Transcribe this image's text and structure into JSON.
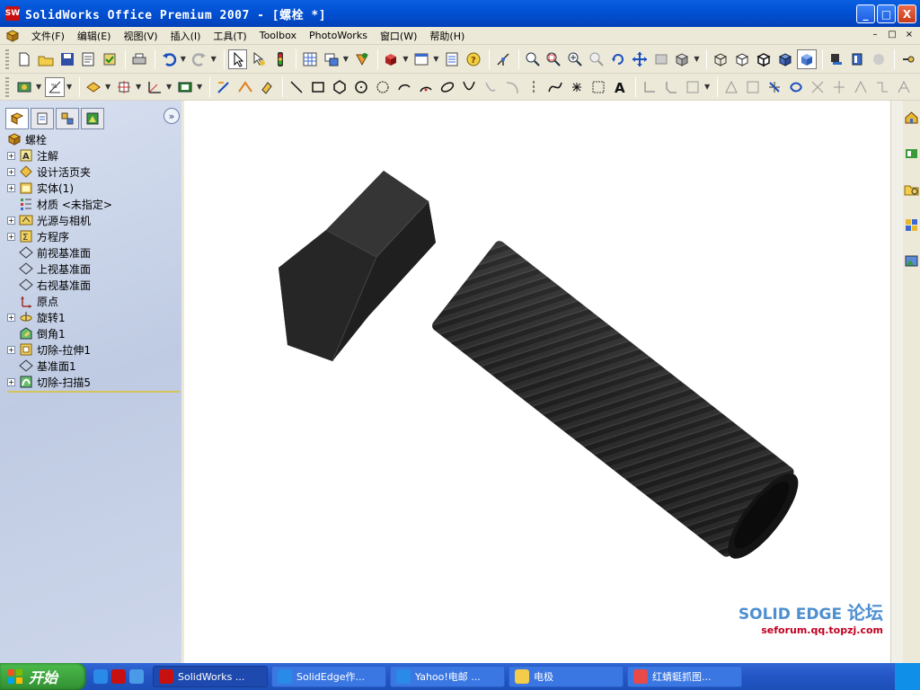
{
  "window": {
    "title": "SolidWorks Office Premium 2007 - [螺栓 *]",
    "app_icon_text": "SW",
    "controls": {
      "minimize": "_",
      "maximize": "□",
      "close": "X"
    }
  },
  "menubar": {
    "items": [
      "文件(F)",
      "编辑(E)",
      "视图(V)",
      "插入(I)",
      "工具(T)",
      "Toolbox",
      "PhotoWorks",
      "窗口(W)",
      "帮助(H)"
    ],
    "mdi_controls": [
      "–",
      "□",
      "×"
    ]
  },
  "toolbar_standard": {
    "icons": [
      "new-icon",
      "open-icon",
      "save-icon",
      "print-preview-icon",
      "rebuild-icon",
      "print-icon",
      "undo-icon",
      "redo-icon",
      "select-icon",
      "sketch-select-icon",
      "traffic-light-icon",
      "grid-icon",
      "options-icon",
      "render-icon",
      "appearance-icon",
      "view-orientation-icon",
      "list-icon",
      "help-icon",
      "zoom-fit-icon",
      "zoom-area-icon",
      "zoom-in-out-icon",
      "zoom-selection-icon",
      "rotate-icon",
      "pan-icon",
      "3d-view-icon",
      "display-style-icon",
      "wireframe-icon",
      "hidden-lines-icon",
      "hidden-removed-icon",
      "shaded-edges-icon",
      "shaded-icon",
      "shadow-icon",
      "perspective-icon",
      "section-icon"
    ]
  },
  "toolbar_sketch": {
    "icons": [
      "sketch-icon",
      "smart-dimension-icon",
      "line-icon",
      "rectangle-icon",
      "polygon-icon",
      "circle-icon",
      "arc-icon",
      "centerpoint-arc-icon",
      "ellipse-icon",
      "parabola-icon",
      "spline-icon",
      "point-icon",
      "centerline-icon",
      "text-icon",
      "mirror-icon",
      "offset-icon",
      "trim-icon",
      "extend-icon",
      "relation-icon",
      "pattern-icon"
    ]
  },
  "feature_manager": {
    "tabs": [
      "feature-tree-tab",
      "property-manager-tab",
      "configuration-tab",
      "dimxpert-tab"
    ],
    "expand_label": "»",
    "root": "螺栓",
    "nodes": [
      {
        "label": "注解",
        "expandable": true,
        "icon": "annotations-icon"
      },
      {
        "label": "设计活页夹",
        "expandable": true,
        "icon": "design-binder-icon"
      },
      {
        "label": "实体(1)",
        "expandable": true,
        "icon": "solid-bodies-icon"
      },
      {
        "label": "材质 <未指定>",
        "expandable": false,
        "icon": "material-icon"
      },
      {
        "label": "光源与相机",
        "expandable": true,
        "icon": "lights-cameras-icon"
      },
      {
        "label": "方程序",
        "expandable": true,
        "icon": "equations-icon"
      },
      {
        "label": "前视基准面",
        "expandable": false,
        "icon": "plane-icon"
      },
      {
        "label": "上视基准面",
        "expandable": false,
        "icon": "plane-icon"
      },
      {
        "label": "右视基准面",
        "expandable": false,
        "icon": "plane-icon"
      },
      {
        "label": "原点",
        "expandable": false,
        "icon": "origin-icon"
      },
      {
        "label": "旋转1",
        "expandable": true,
        "icon": "revolve-icon"
      },
      {
        "label": "倒角1",
        "expandable": false,
        "icon": "chamfer-icon"
      },
      {
        "label": "切除-拉伸1",
        "expandable": true,
        "icon": "cut-extrude-icon"
      },
      {
        "label": "基准面1",
        "expandable": false,
        "icon": "plane-icon"
      },
      {
        "label": "切除-扫描5",
        "expandable": true,
        "icon": "cut-sweep-icon"
      }
    ]
  },
  "viewport": {
    "model": "hex-bolt",
    "watermark_title": "SOLID EDGE",
    "watermark_title_cn": "论坛",
    "watermark_sub": "seforum.qq.topzj.com"
  },
  "taskpane": {
    "icons": [
      "home-icon",
      "design-library-icon",
      "file-explorer-icon",
      "view-palette-icon",
      "appearance-scenes-icon"
    ]
  },
  "taskbar": {
    "start_label": "开始",
    "quick_launch": [
      "ie-icon",
      "solidworks-icon",
      "desktop-icon"
    ],
    "tasks": [
      {
        "label": "SolidWorks ...",
        "icon": "solidworks-icon",
        "active": true
      },
      {
        "label": "SolidEdge作...",
        "icon": "ie-icon",
        "active": false
      },
      {
        "label": "Yahoo!电邮 ...",
        "icon": "ie-icon",
        "active": false
      },
      {
        "label": "电极",
        "icon": "folder-icon",
        "active": false
      },
      {
        "label": "红蜻蜓抓图...",
        "icon": "camera-icon",
        "active": false
      }
    ]
  },
  "colors": {
    "titlebar": "#0252d6",
    "chrome": "#ece9d8",
    "tree_bg": "#c4cfe6",
    "bolt": "#2a2a2a",
    "taskbar": "#2456c7",
    "start": "#318f31"
  }
}
